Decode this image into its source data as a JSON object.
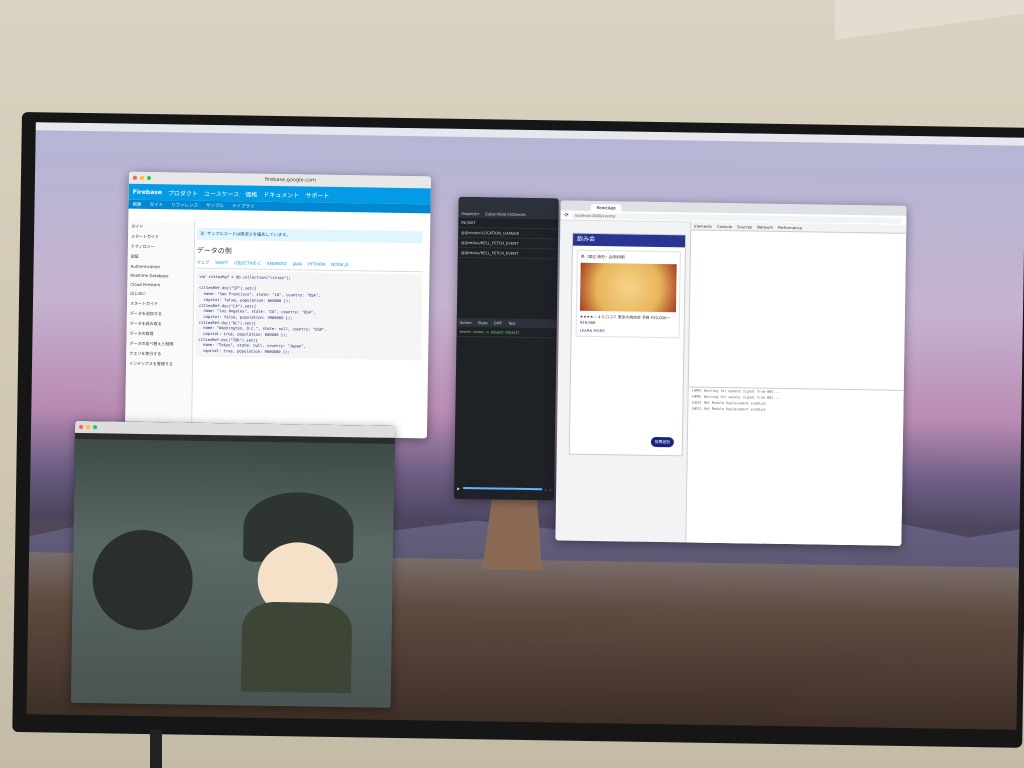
{
  "firebase": {
    "title": "firebase.google.com",
    "brand": "Firebase",
    "nav": [
      "プロダクト",
      "ユースケース",
      "価格",
      "ドキュメント",
      "サポート"
    ],
    "tabs": [
      "概要",
      "ガイド",
      "リファレンス",
      "サンプル",
      "ライブラリ"
    ],
    "sidebar": [
      "ガイド",
      "スタートガイド",
      "テクノロジー",
      "認証",
      "Authentication",
      "Realtime Database",
      "Cloud Firestore",
      "はじめに",
      "スタートガイド",
      "データを追加する",
      "データを読み取る",
      "データの取得",
      "データの並べ替えと制限",
      "クエリを実行する",
      "インデックスを管理する"
    ],
    "section_title": "データの例",
    "note": "注: サンプルコードは簡潔さを優先しています。",
    "code_lang_tabs": [
      "ウェブ",
      "SWIFT",
      "OBJECTIVE-C",
      "ANDROID",
      "JAVA",
      "PYTHON",
      "NODE.JS"
    ],
    "code": "var citiesRef = db.collection(\"cities\");\n\ncitiesRef.doc(\"SF\").set({\n  name: \"San Francisco\", state: \"CA\", country: \"USA\",\n  capital: false, population: 860000 });\ncitiesRef.doc(\"LA\").set({\n  name: \"Los Angeles\", state: \"CA\", country: \"USA\",\n  capital: false, population: 3900000 });\ncitiesRef.doc(\"DC\").set({\n  name: \"Washington, D.C.\", state: null, country: \"USA\",\n  capital: true, population: 680000 });\ncitiesRef.doc(\"TOK\").set({\n  name: \"Tokyo\", state: null, country: \"Japan\",\n  capital: true, population: 9000000 });"
  },
  "inspector": {
    "tabs": [
      "Inspector",
      "Subscribed Instances"
    ],
    "events": [
      "INCINIT",
      "@@router/LOCATION_CHANGE",
      "@@redux/RELL_FETCH_EVENT",
      "@@redux/RELL_FETCH_EVENT"
    ],
    "bottom_tabs": [
      "Action",
      "State",
      "DIFF",
      "Test"
    ],
    "diff_line": "event: name -> [object Object]"
  },
  "chrome": {
    "tab_label": "ReactApp",
    "url": "localhost:3000/events/",
    "app_title": "飲み会",
    "card_subtitle": "鳥（渡辺 焼肉・会席料理）",
    "card_text": "★★★★☆ 4.5 口コミ 東京の焼肉店 予算 ¥20,000～¥29,999",
    "learn_more": "LEARN MORE",
    "fab": "投票追加",
    "devtabs": [
      "Elements",
      "Console",
      "Sources",
      "Network",
      "Performance"
    ],
    "console_lines": [
      "[HMR] Waiting for update signal from WDS...",
      "[HMR] Waiting for update signal from WDS...",
      "[WDS] Hot Module Replacement enabled.",
      "[WDS] Hot Module Replacement enabled."
    ]
  }
}
